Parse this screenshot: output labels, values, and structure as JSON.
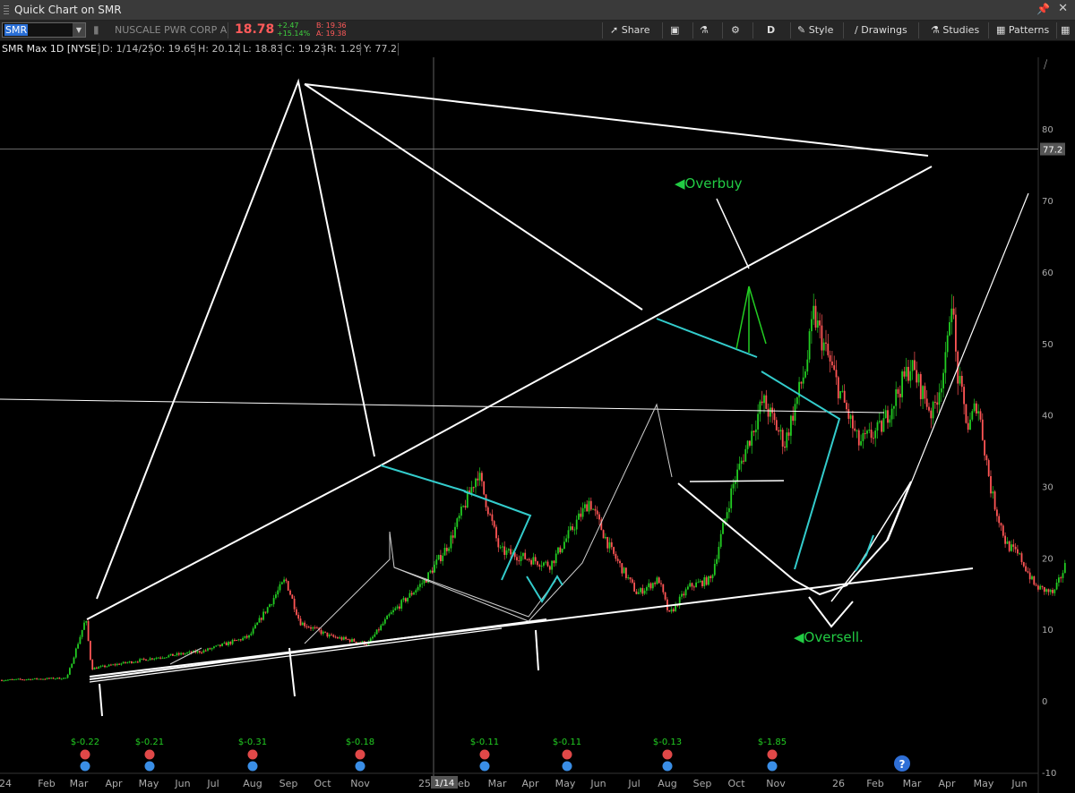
{
  "window": {
    "title": "Quick Chart on SMR"
  },
  "toolbar": {
    "symbol": "SMR",
    "company": "NUSCALE PWR CORP A",
    "last": "18.78",
    "change": "+2.47",
    "change_pct": "+15.14%",
    "bid": "B: 19.36",
    "ask": "A: 19.38",
    "share": "Share",
    "timeframe": "D",
    "style": "Style",
    "drawings": "Drawings",
    "studies": "Studies",
    "patterns": "Patterns"
  },
  "info": {
    "title": "SMR Max 1D [NYSE]",
    "date": "D: 1/14/25",
    "open": "O: 19.65",
    "high": "H: 20.12",
    "low": "L: 18.83",
    "close": "C: 19.23",
    "range": "R: 1.29",
    "y": "Y: 77.2"
  },
  "colors": {
    "up": "#22cc22",
    "down": "#ff5555",
    "annotation": "#22cc44",
    "cyan": "#33cccc",
    "line": "#ffffff"
  },
  "chart_data": {
    "type": "candlestick",
    "y_range": [
      -10,
      90
    ],
    "yticks": [
      -10,
      0,
      10,
      20,
      30,
      40,
      50,
      60,
      70,
      80
    ],
    "crosshair_value": 77.2,
    "crosshair_label": "77.2",
    "cursor_date_label": "1/14",
    "xticks": [
      "24",
      "Feb",
      "Mar",
      "Apr",
      "May",
      "Jun",
      "Jul",
      "Aug",
      "Sep",
      "Oct",
      "Nov",
      "25",
      "Feb",
      "Mar",
      "Apr",
      "May",
      "Jun",
      "Jul",
      "Aug",
      "Sep",
      "Oct",
      "Nov",
      "26",
      "Feb",
      "Mar",
      "Apr",
      "May",
      "Jun"
    ],
    "price_path": [
      [
        "2024-01-01",
        2.9
      ],
      [
        "2024-02-15",
        3.2
      ],
      [
        "2024-02-28",
        11.5
      ],
      [
        "2024-03-03",
        4.5
      ],
      [
        "2024-04-15",
        6
      ],
      [
        "2024-05-20",
        7
      ],
      [
        "2024-06-20",
        9
      ],
      [
        "2024-07-15",
        17
      ],
      [
        "2024-07-25",
        11
      ],
      [
        "2024-08-15",
        9
      ],
      [
        "2024-09-10",
        8
      ],
      [
        "2024-09-25",
        12
      ],
      [
        "2024-10-20",
        17
      ],
      [
        "2024-11-05",
        22
      ],
      [
        "2024-11-25",
        32
      ],
      [
        "2024-12-10",
        21
      ],
      [
        "2024-12-28",
        20
      ],
      [
        "2025-01-14",
        19
      ],
      [
        "2025-02-10",
        28
      ],
      [
        "2025-02-25",
        21
      ],
      [
        "2025-03-15",
        15
      ],
      [
        "2025-03-30",
        17
      ],
      [
        "2025-04-06",
        12
      ],
      [
        "2025-04-20",
        16
      ],
      [
        "2025-05-05",
        17
      ],
      [
        "2025-05-20",
        30
      ],
      [
        "2025-06-10",
        42
      ],
      [
        "2025-06-25",
        36
      ],
      [
        "2025-07-10",
        47
      ],
      [
        "2025-07-15",
        54
      ],
      [
        "2025-07-30",
        45
      ],
      [
        "2025-08-15",
        36
      ],
      [
        "2025-08-30",
        38
      ],
      [
        "2025-09-20",
        47
      ],
      [
        "2025-10-05",
        40
      ],
      [
        "2025-10-15",
        48
      ],
      [
        "2025-10-18",
        58
      ],
      [
        "2025-10-22",
        46
      ],
      [
        "2025-10-30",
        38
      ],
      [
        "2025-11-05",
        42
      ],
      [
        "2025-11-15",
        29
      ],
      [
        "2025-11-25",
        22
      ],
      [
        "2025-12-05",
        20
      ],
      [
        "2025-12-15",
        16
      ],
      [
        "2025-12-28",
        15
      ],
      [
        "2026-01-05",
        19
      ]
    ],
    "earnings": [
      {
        "label": "$-0.22"
      },
      {
        "label": "$-0.21"
      },
      {
        "label": "$-0.31"
      },
      {
        "label": "$-0.18"
      },
      {
        "label": "$-0.11"
      },
      {
        "label": "$-0.11"
      },
      {
        "label": "$-0.13"
      },
      {
        "label": "$-1.85"
      }
    ],
    "annotations": [
      {
        "text": "Overbuy"
      },
      {
        "text": "Oversell."
      }
    ],
    "help_label": "?"
  }
}
